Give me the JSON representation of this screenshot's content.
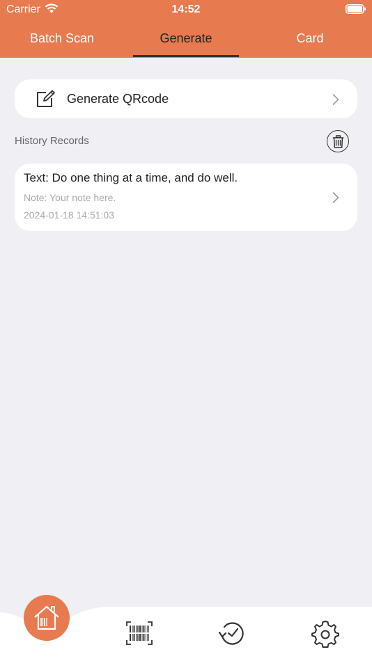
{
  "status_bar": {
    "carrier": "Carrier",
    "time": "14:52"
  },
  "tabs": [
    {
      "label": "Batch Scan",
      "active": false
    },
    {
      "label": "Generate",
      "active": true
    },
    {
      "label": "Card",
      "active": false
    }
  ],
  "generate_card": {
    "label": "Generate QRcode",
    "icon": "edit-icon"
  },
  "history": {
    "title": "History Records",
    "clear_icon": "trash-icon",
    "records": [
      {
        "text": "Text: Do one thing at a time, and do well.",
        "note": "Note: Your note here.",
        "date": "2024-01-18 14:51:03"
      }
    ]
  },
  "bottom_nav": {
    "items": [
      "home-icon",
      "barcode-icon",
      "history-icon",
      "settings-icon"
    ]
  },
  "colors": {
    "accent": "#e87a50",
    "background": "#efeff4",
    "card": "#ffffff"
  }
}
